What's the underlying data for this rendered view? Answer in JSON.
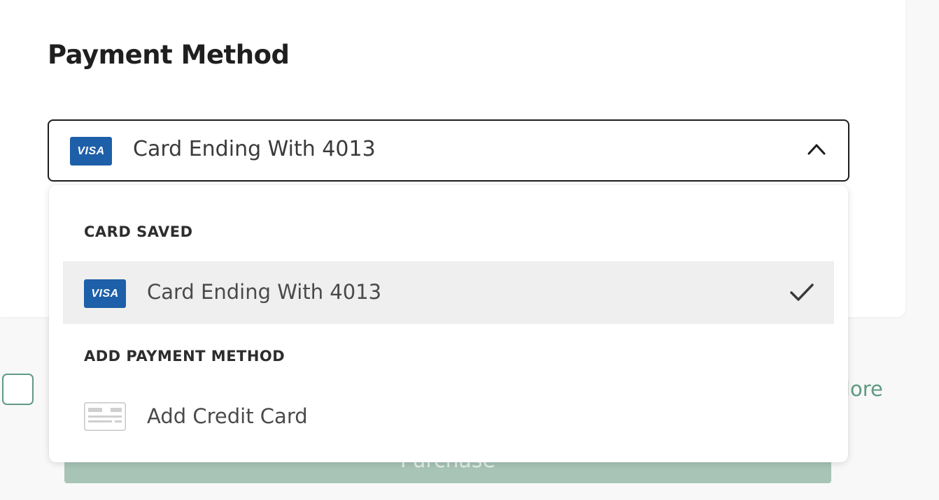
{
  "payment": {
    "title": "Payment Method",
    "selected_label": "Card Ending With 4013",
    "selected_card_brand": "VISA"
  },
  "dropdown": {
    "saved_header": "CARD SAVED",
    "saved_items": [
      {
        "brand": "VISA",
        "label": "Card Ending With 4013",
        "selected": true
      }
    ],
    "add_header": "ADD PAYMENT METHOD",
    "add_items": [
      {
        "label": "Add Credit Card",
        "icon": "credit-card-icon"
      }
    ]
  },
  "background": {
    "more_label": "More",
    "purchase_label": "Purchase"
  },
  "icons": {
    "expand": "chevron-up-icon",
    "selected": "checkmark-icon",
    "card": "credit-card-icon",
    "brand": "visa-icon"
  },
  "colors": {
    "visa_blue": "#1d5fa8",
    "accent_green": "#5f9a82",
    "purchase_disabled": "#a7c4b7",
    "selected_row": "#efefef",
    "border_dark": "#1c1c1c"
  }
}
